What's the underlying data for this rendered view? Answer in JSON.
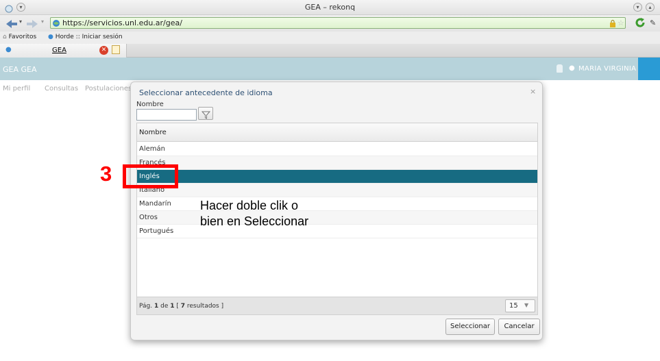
{
  "window": {
    "title": "GEA – rekonq"
  },
  "browser": {
    "url": "https://servicios.unl.edu.ar/gea/",
    "bookmarks": [
      "Favoritos",
      "Horde :: Iniciar sesión"
    ],
    "tab_title": "GEA"
  },
  "app": {
    "brand": "GEA GEA",
    "user_name": "MARÍA VIRGINIA C",
    "nav": [
      "Mi perfil",
      "Consultas",
      "Postulaciones"
    ]
  },
  "dialog": {
    "title": "Seleccionar antecedente de idioma",
    "close_label": "×",
    "filter_label": "Nombre",
    "filter_value": "",
    "column_header": "Nombre",
    "rows": [
      "Alemán",
      "Francés",
      "Inglés",
      "Italiano",
      "Mandarín",
      "Otros",
      "Portugués"
    ],
    "selected_row": "Inglés",
    "pager": {
      "page": "1",
      "total_pages": "1",
      "results": "7",
      "page_size": "15"
    },
    "pager_text": {
      "prefix": "Pág. ",
      "of": " de ",
      "open": " [ ",
      "suffix": " resultados ]"
    },
    "buttons": {
      "select": "Seleccionar",
      "cancel": "Cancelar"
    }
  },
  "annotation": {
    "step_number": "3",
    "instruction": "Hacer doble clik o\nbien en Seleccionar",
    "color": "#ff0000"
  },
  "colors": {
    "header": "#b7d3db",
    "selected_row": "#176b82",
    "accent": "#2a9bd5"
  }
}
